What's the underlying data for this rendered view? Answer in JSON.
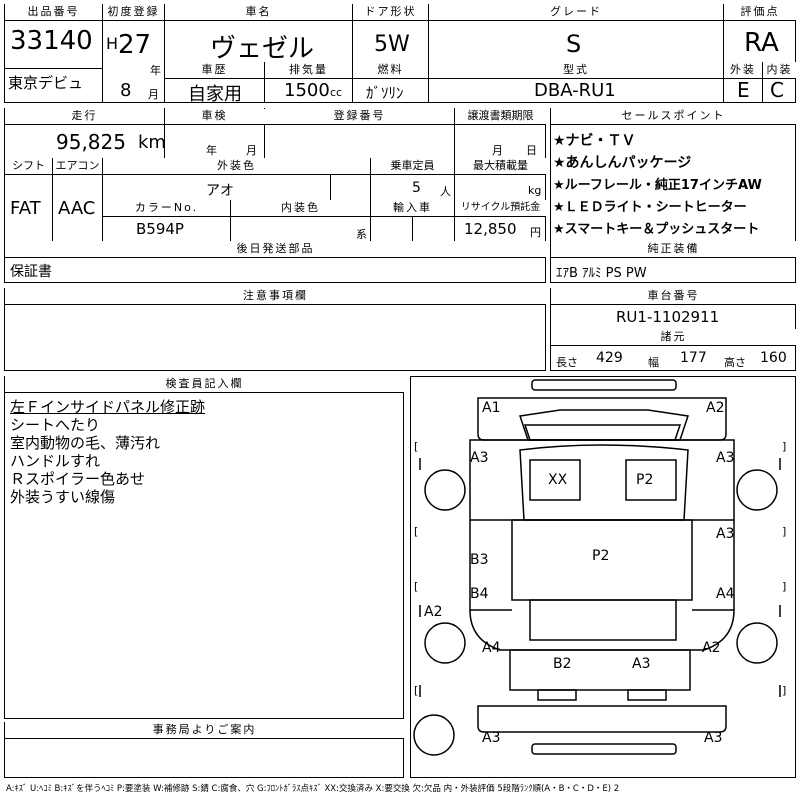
{
  "header": {
    "lot_label": "出品番号",
    "lot_no": "33140",
    "reg_label": "初度登録",
    "era": "H",
    "year": "27",
    "year_unit": "年",
    "month": "8",
    "month_unit": "月",
    "model_label": "車名",
    "model": "ヴェゼル",
    "door_label": "ドア形状",
    "door": "5W",
    "grade_label": "グレード",
    "grade": "S",
    "score_label": "評価点",
    "score": "RA",
    "debut": "東京デビュ",
    "history_label": "車歴",
    "history": "自家用",
    "disp_label": "排気量",
    "disp": "1500",
    "disp_unit": "cc",
    "fuel_label": "燃料",
    "fuel": "ｶﾞｿﾘﾝ",
    "type_label": "型式",
    "type": "DBA-RU1",
    "ext_label": "外装",
    "ext": "E",
    "int_label": "内装",
    "int": "C"
  },
  "row2": {
    "mileage_label": "走行",
    "mileage": "95,825",
    "mileage_unit": "km",
    "inspect_label": "車検",
    "inspect_y": "年",
    "inspect_m": "月",
    "plate_label": "登録番号",
    "transfer_label": "譲渡書類期限",
    "transfer_m": "月",
    "transfer_d": "日",
    "shift_label": "シフト",
    "shift": "FAT",
    "ac_label": "エアコン",
    "ac": "AAC",
    "color_label": "外装色",
    "color": "アオ",
    "seats_label": "乗車定員",
    "seats": "5",
    "seats_unit": "人",
    "load_label": "最大積載量",
    "load_unit": "kg",
    "colorno_label": "カラーNo.",
    "colorno": "B594P",
    "intcolor_label": "内装色",
    "intcolor_unit": "系",
    "import_label": "輸入車",
    "recycle_label": "リサイクル預託金",
    "recycle": "12,850",
    "recycle_unit": "円",
    "later_label": "後日発送部品",
    "later": "保証書"
  },
  "sales": {
    "label": "セールスポイント",
    "items": [
      "★ナビ・ＴＶ",
      "★あんしんパッケージ",
      "★ルーフレール・純正17インチAW",
      "★ＬＥＤライト・シートヒーター",
      "★スマートキー＆プッシュスタート"
    ]
  },
  "equip": {
    "label": "純正装備",
    "value": "ｴｱB ｱﾙﾐ PS PW"
  },
  "notes": {
    "label": "注意事項欄"
  },
  "chassis": {
    "label": "車台番号",
    "value": "RU1-1102911",
    "dims_label": "諸元",
    "len_label": "長さ",
    "len": "429",
    "wid_label": "幅",
    "wid": "177",
    "hgt_label": "高さ",
    "hgt": "160"
  },
  "inspector": {
    "label": "検査員記入欄",
    "lines": [
      "左Ｆインサイドパネル修正跡",
      "シートへたり",
      "室内動物の毛、薄汚れ",
      "ハンドルすれ",
      "Ｒスポイラー色あせ",
      "外装うすい線傷"
    ]
  },
  "office": {
    "label": "事務局よりご案内"
  },
  "diagram": {
    "marks": [
      "A1",
      "A2",
      "A3",
      "A3",
      "XX",
      "P2",
      "A3",
      "P2",
      "B3",
      "B4",
      "A4",
      "A2",
      "A4",
      "A2",
      "B2",
      "A3",
      "A3",
      "A3"
    ],
    "brackets": [
      "[",
      "]",
      "[",
      "]",
      "[",
      "]",
      "[",
      "]"
    ]
  },
  "legend": "A:ｷｽﾞ U:ﾍｺﾐ B:ｷｽﾞを伴うﾍｺﾐ P:要塗装 W:補修跡 S:錆 C:腐食、穴 G:ﾌﾛﾝﾄｶﾞﾗｽ点ｷｽﾞ XX:交換済み X:要交換 欠:欠品 内・外装評価 5段階ﾗﾝｸ順(A・B・C・D・E) 2"
}
